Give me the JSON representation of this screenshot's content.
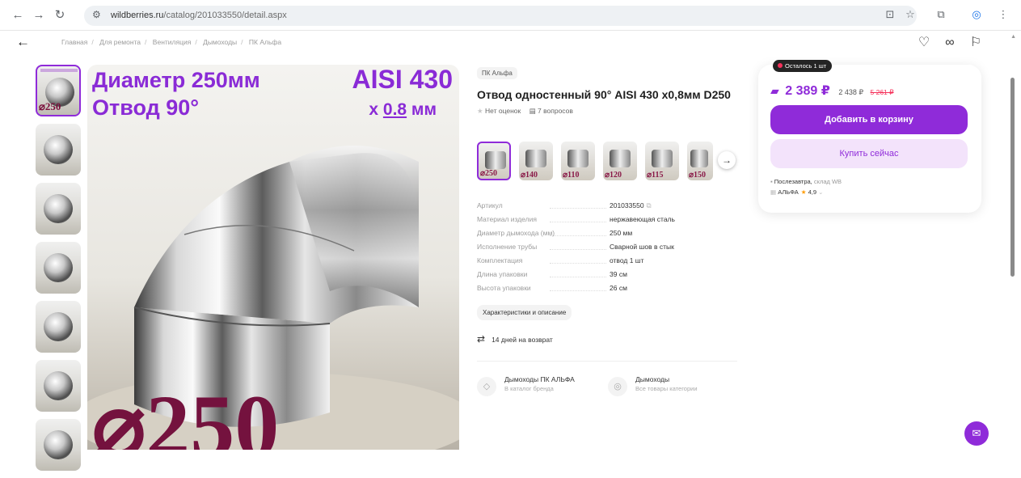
{
  "browser": {
    "url_host": "wildberries.ru",
    "url_path": "/catalog/201033550/detail.aspx",
    "icons": [
      "back-arrow-icon",
      "forward-arrow-icon",
      "reload-icon",
      "site-settings-icon",
      "install-icon",
      "star-icon",
      "extensions-icon",
      "profile-icon",
      "menu-icon"
    ]
  },
  "breadcrumb": [
    "Главная",
    "Для ремонта",
    "Вентиляция",
    "Дымоходы",
    "ПК Альфа"
  ],
  "image_text": {
    "line1": "Диаметр 250мм",
    "line2": "Отвод 90°",
    "steel": "AISI 430",
    "thickness_prefix": "х ",
    "thickness_value": "0.8",
    "thickness_unit": " мм",
    "big_label": "⌀250",
    "thumb_label": "⌀250"
  },
  "product": {
    "brand_chip": "ПК Альфа",
    "title": "Отвод одностенный 90° AISI 430 х0,8мм D250",
    "rating_text": "Нет оценок",
    "questions_text": "7 вопросов",
    "gallery_labels": [
      "⌀250",
      "⌀140",
      "⌀110",
      "⌀120",
      "⌀115",
      "⌀150"
    ]
  },
  "specs": [
    {
      "k": "Артикул",
      "v": "201033550"
    },
    {
      "k": "Материал изделия",
      "v": "нержавеющая сталь"
    },
    {
      "k": "Диаметр дымохода (мм)",
      "v": "250 мм"
    },
    {
      "k": "Исполнение трубы",
      "v": "Сварной шов в стык"
    },
    {
      "k": "Комплектация",
      "v": "отвод 1 шт"
    },
    {
      "k": "Длина упаковки",
      "v": "39 см"
    },
    {
      "k": "Высота упаковки",
      "v": "26 см"
    }
  ],
  "actions": {
    "chars_button": "Характеристики и описание",
    "return_text": "14 дней на возврат"
  },
  "links": [
    {
      "title": "Дымоходы ПК АЛЬФА",
      "sub": "В каталог бренда"
    },
    {
      "title": "Дымоходы",
      "sub": "Все товары категории"
    }
  ],
  "buy_box": {
    "stock_badge": "Осталось 1 шт",
    "price_wallet": "2 389 ₽",
    "price_regular": "2 438 ₽",
    "price_old": "5 261 ₽",
    "add_to_cart": "Добавить в корзину",
    "buy_now": "Купить сейчас",
    "delivery_strong": "Послезавтра,",
    "delivery_muted": " склад WB",
    "seller_name": "АЛЬФА",
    "seller_rating": "4,9",
    "accent": "#8f2bd9",
    "sale_color": "#f5315a"
  }
}
